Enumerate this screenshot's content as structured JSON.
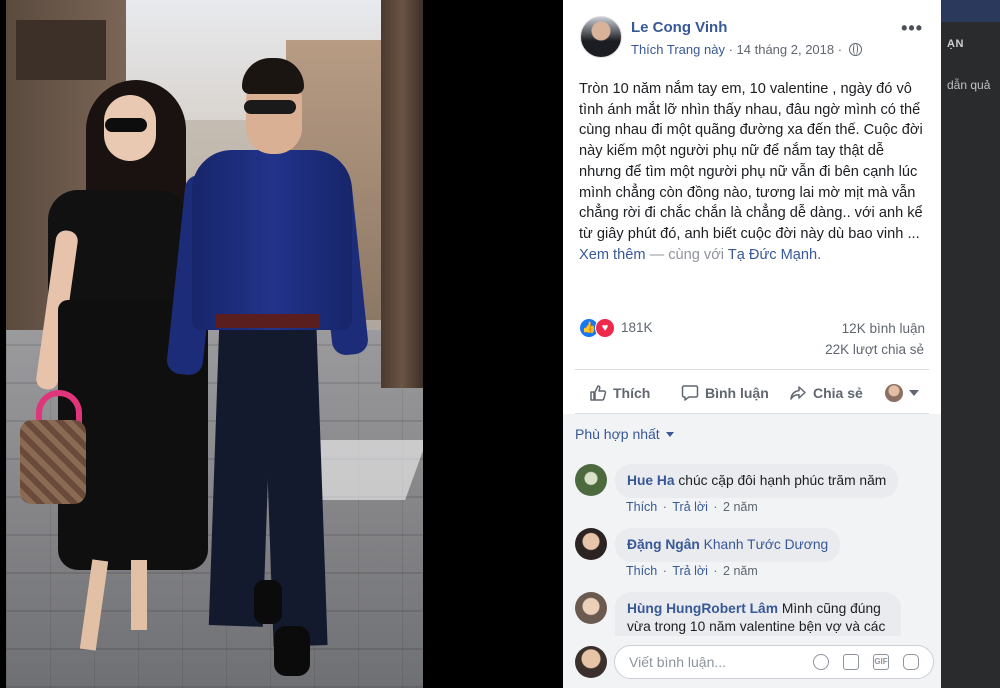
{
  "post": {
    "page_name": "Le Cong Vinh",
    "like_page": "Thích Trang này",
    "date": "14 tháng 2, 2018",
    "more": "•••",
    "text": "Tròn 10 năm nắm tay em, 10 valentine , ngày đó vô tình ánh mắt lỡ nhìn thấy nhau, đâu ngờ mình có thể cùng nhau đi một quãng đường xa đến thế. Cuộc đời này kiếm một người phụ nữ để nắm tay thật dễ nhưng để tìm một người phụ nữ vẫn đi bên cạnh lúc mình chẳng còn đồng nào, tương lai mờ mịt mà vẫn chẳng rời đi chắc chắn là chẳng dễ dàng.. với anh kể từ giây phút đó, anh biết cuộc đời này dù bao vinh ...",
    "see_more": "Xem thêm",
    "with_text": "— cùng với",
    "tagged": "Tạ Đức Mạnh."
  },
  "stats": {
    "reactions": "181K",
    "comments": "12K bình luận",
    "shares": "22K lượt chia sẻ"
  },
  "actions": {
    "like": "Thích",
    "comment": "Bình luận",
    "share": "Chia sẻ"
  },
  "comments_section": {
    "sort": "Phù hợp nhất",
    "items": [
      {
        "author": "Hue Ha",
        "text": "chúc cặp đôi hạnh phúc trăm năm",
        "like": "Thích",
        "reply": "Trả lời",
        "time": "2 năm"
      },
      {
        "author": "Đặng Ngân",
        "tag": "Khanh Tước Dương",
        "text": "",
        "like": "Thích",
        "reply": "Trả lời",
        "time": "2 năm"
      },
      {
        "author": "Hùng Hung",
        "tag": "Robert Lâm",
        "text": "Mình cũng đúng vừa trong 10 năm valentine bện vợ và các"
      }
    ],
    "composer_placeholder": "Viết bình luận..."
  },
  "background": {
    "right_title": "ẠN",
    "right_text": "dẫn quả"
  },
  "colors": {
    "link": "#385898",
    "muted": "#606770",
    "like_blue": "#1877f2",
    "love_red": "#f0284a"
  },
  "icons": [
    "globe-icon",
    "more-icon",
    "like-reaction-icon",
    "love-reaction-icon",
    "thumbs-up-icon",
    "comment-icon",
    "share-icon",
    "audience-avatar-icon",
    "chevron-down-icon",
    "emoji-icon",
    "camera-icon",
    "gif-icon",
    "sticker-icon"
  ]
}
